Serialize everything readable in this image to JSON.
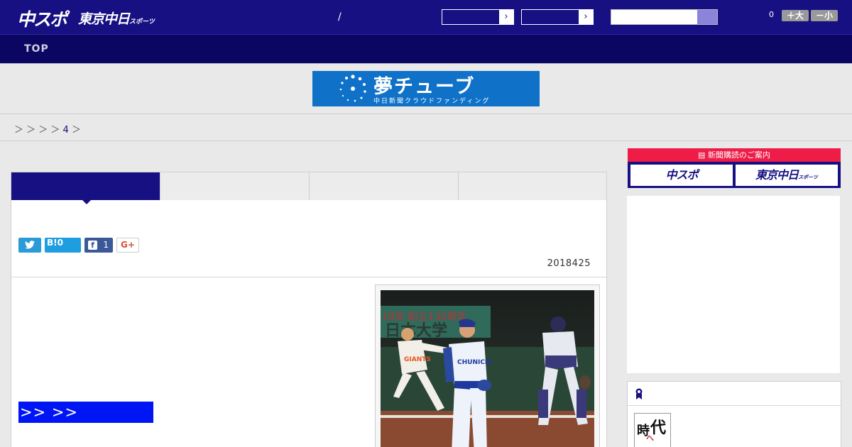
{
  "header": {
    "logo_main": "中スポ",
    "logo_sub": "東京中日",
    "logo_sub_small": "スポーツ",
    "slash": "/",
    "select_arrow": "›",
    "font_count": "0",
    "font_larger": "＋大",
    "font_smaller": "－小"
  },
  "nav": {
    "top_label": "TOP"
  },
  "banner": {
    "title": "夢チューブ",
    "subtitle": "中日新聞クラウドファンディング"
  },
  "breadcrumb": {
    "seps": "＞ ＞ ＞ ＞",
    "link": "4",
    "tail": "＞"
  },
  "share": {
    "twitter_icon": "twitter-icon",
    "hatena_label": "B!",
    "hatena_count": "0",
    "facebook_glyph": "f",
    "facebook_count": "1",
    "gplus_label": "G+"
  },
  "article": {
    "date": "2018425",
    "more_link": ">> >>",
    "photo_text": {
      "banner_text": "19年 創立130周年",
      "big_text": "日本大学",
      "giants": "GIANTS",
      "chunichi": "CHUNICHI"
    }
  },
  "sidebar": {
    "subscribe_header": "新聞購読のご案内",
    "subscribe_chuspo": "中スポ",
    "subscribe_tokyo": "東京中日",
    "subscribe_tokyo_small": "スポーツ",
    "thumb_char1": "時",
    "thumb_char2": "代",
    "thumb_char3": "へ"
  },
  "colors": {
    "brand_navy": "#161082",
    "nav_dark": "#0c0663",
    "link_blue": "#0015f4",
    "red": "#ee1c47"
  }
}
